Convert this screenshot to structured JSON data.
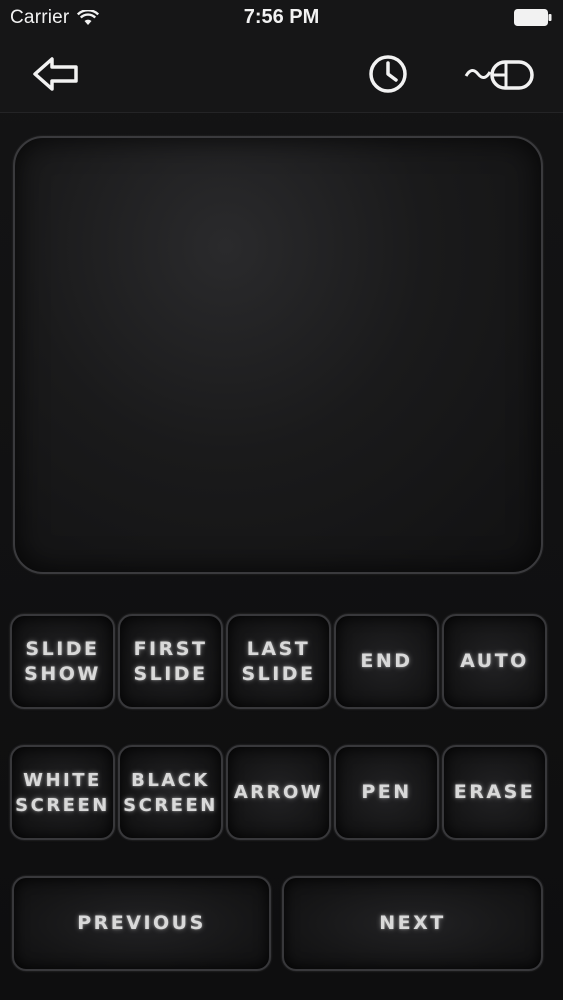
{
  "status_bar": {
    "carrier": "Carrier",
    "time": "7:56 PM",
    "wifi_icon": "wifi-icon",
    "battery_icon": "battery-icon"
  },
  "nav_bar": {
    "back_icon": "back-arrow-icon",
    "history_icon": "clock-icon",
    "mouse_icon": "mouse-icon"
  },
  "trackpad": {
    "label": ""
  },
  "row1": [
    {
      "label": "SLIDE\nSHOW"
    },
    {
      "label": "FIRST\nSLIDE"
    },
    {
      "label": "LAST\nSLIDE"
    },
    {
      "label": "END"
    },
    {
      "label": "AUTO"
    }
  ],
  "row2": [
    {
      "label": "WHITE\nSCREEN"
    },
    {
      "label": "BLACK\nSCREEN"
    },
    {
      "label": "ARROW"
    },
    {
      "label": "PEN"
    },
    {
      "label": "ERASE"
    }
  ],
  "row3": [
    {
      "label": "PREVIOUS"
    },
    {
      "label": "NEXT"
    }
  ],
  "colors": {
    "background": "#111112",
    "button_text": "#d9d9d9",
    "border": "#38383b"
  }
}
